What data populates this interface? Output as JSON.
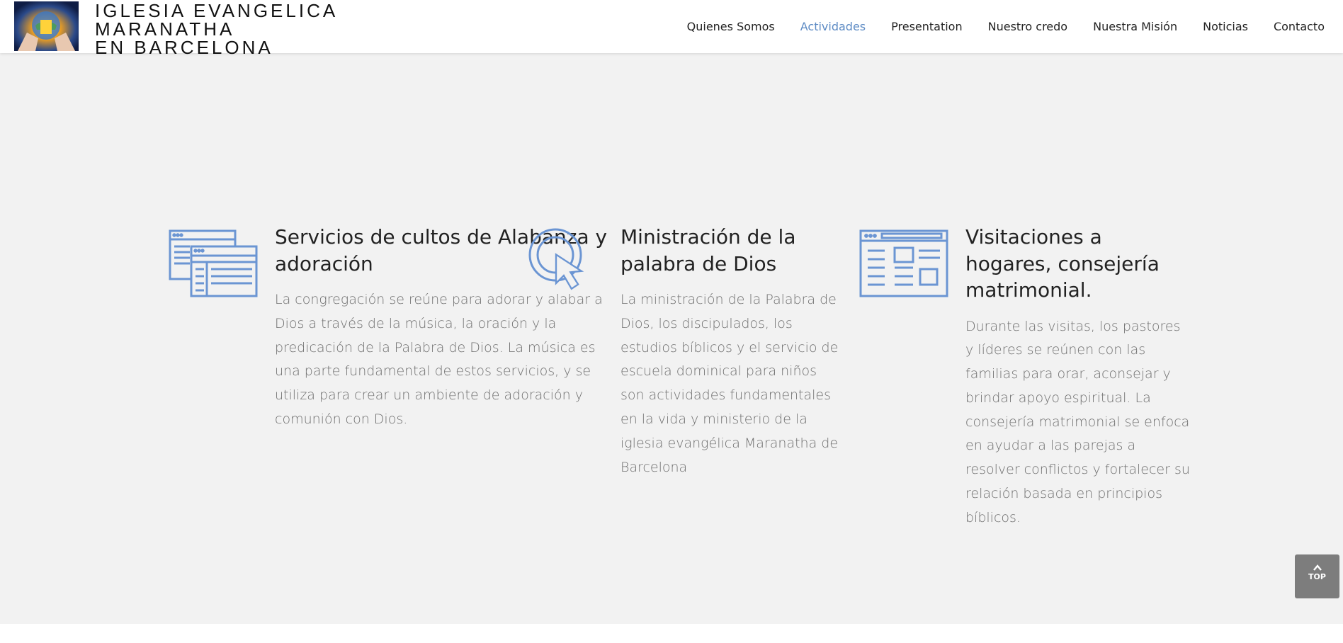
{
  "header": {
    "logo_lines": [
      "IGLESIA EVANGELICA",
      "MARANATHA",
      "EN BARCELONA"
    ],
    "nav": [
      {
        "label": "Quienes Somos",
        "active": false
      },
      {
        "label": "Actividades",
        "active": true
      },
      {
        "label": "Presentation",
        "active": false
      },
      {
        "label": "Nuestro credo",
        "active": false
      },
      {
        "label": "Nuestra Misión",
        "active": false
      },
      {
        "label": "Noticias",
        "active": false
      },
      {
        "label": "Contacto",
        "active": false
      }
    ]
  },
  "colors": {
    "accent": "#5d8bc4",
    "icon_blue": "#6b95d3",
    "background": "#f2f2f2",
    "heading": "#222222",
    "body_text": "#6f6f6f",
    "top_button": "#7d7d7d"
  },
  "features": [
    {
      "icon": "browser-windows-icon",
      "title": "Servicios de cultos de Alabanza y adoración",
      "body": "La congregación se reúne para adorar y alabar a Dios a través de la música, la oración y la predicación de la Palabra de Dios. La música es una parte fundamental de estos servicios, y se utiliza para crear un ambiente de adoración y comunión con Dios."
    },
    {
      "icon": "cursor-click-icon",
      "title": "Ministración de la palabra de Dios",
      "body": "La ministración de la Palabra de Dios, los discipulados, los estudios bíblicos y el servicio de escuela dominical para niños son actividades fundamentales en la vida y ministerio de la iglesia evangélica Maranatha de Barcelona"
    },
    {
      "icon": "webpage-layout-icon",
      "title": "Visitaciones a hogares, consejería matrimonial.",
      "body": "Durante las visitas, los pastores y líderes se reúnen con las familias para orar, aconsejar y brindar apoyo espiritual. La consejería matrimonial se enfoca en ayudar a las parejas a resolver conflictos y fortalecer su relación basada en principios bíblicos."
    }
  ],
  "back_to_top": {
    "label": "TOP",
    "icon": "chevron-up-icon"
  }
}
